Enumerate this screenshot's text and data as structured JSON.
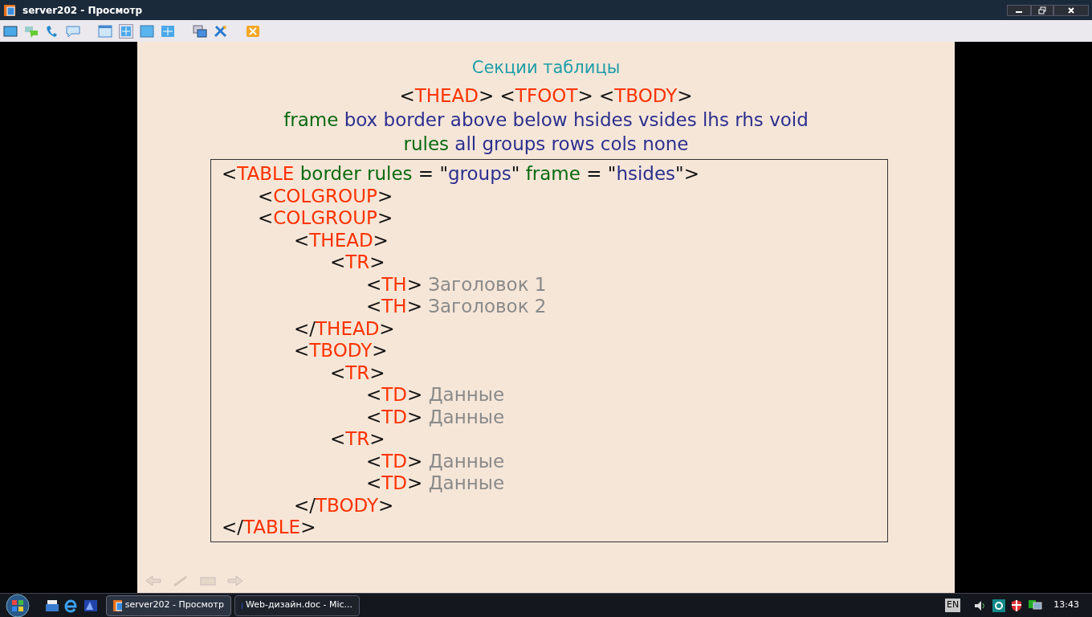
{
  "window": {
    "title": "server202 - Просмотр"
  },
  "slide": {
    "title": "Секции таблицы",
    "headings": [
      [
        {
          "kind": "punct",
          "text": "<"
        },
        {
          "kind": "tag",
          "text": "THEAD"
        },
        {
          "kind": "punct",
          "text": "> <"
        },
        {
          "kind": "tag",
          "text": "TFOOT"
        },
        {
          "kind": "punct",
          "text": "> <"
        },
        {
          "kind": "tag",
          "text": "TBODY"
        },
        {
          "kind": "punct",
          "text": ">"
        }
      ],
      [
        {
          "kind": "attr",
          "text": "frame"
        },
        {
          "kind": "value",
          "text": " box border above below hsides vsides lhs rhs void"
        }
      ],
      [
        {
          "kind": "attr",
          "text": "rules"
        },
        {
          "kind": "value",
          "text": " all groups rows cols none"
        }
      ]
    ],
    "code": [
      {
        "parts": [
          {
            "kind": "punct",
            "text": "<"
          },
          {
            "kind": "tag",
            "text": "TABLE"
          },
          {
            "kind": "attr",
            "text": " border rules"
          },
          {
            "kind": "punct",
            "text": " = \""
          },
          {
            "kind": "value",
            "text": "groups"
          },
          {
            "kind": "punct",
            "text": "\""
          },
          {
            "kind": "attr",
            "text": " frame"
          },
          {
            "kind": "punct",
            "text": " = \""
          },
          {
            "kind": "value",
            "text": "hsides"
          },
          {
            "kind": "punct",
            "text": "\">"
          }
        ],
        "children": [
          {
            "parts": [
              {
                "kind": "punct",
                "text": "<"
              },
              {
                "kind": "tag",
                "text": "COLGROUP"
              },
              {
                "kind": "punct",
                "text": ">"
              }
            ]
          },
          {
            "parts": [
              {
                "kind": "punct",
                "text": "<"
              },
              {
                "kind": "tag",
                "text": "COLGROUP"
              },
              {
                "kind": "punct",
                "text": ">"
              }
            ],
            "children": [
              {
                "parts": [
                  {
                    "kind": "punct",
                    "text": "<"
                  },
                  {
                    "kind": "tag",
                    "text": "THEAD"
                  },
                  {
                    "kind": "punct",
                    "text": ">"
                  }
                ],
                "children": [
                  {
                    "parts": [
                      {
                        "kind": "punct",
                        "text": "<"
                      },
                      {
                        "kind": "tag",
                        "text": "TR"
                      },
                      {
                        "kind": "punct",
                        "text": ">"
                      }
                    ],
                    "children": [
                      {
                        "parts": [
                          {
                            "kind": "punct",
                            "text": "<"
                          },
                          {
                            "kind": "tag",
                            "text": "TH"
                          },
                          {
                            "kind": "punct",
                            "text": ">"
                          },
                          {
                            "kind": "text",
                            "text": " Заголовок 1"
                          }
                        ]
                      },
                      {
                        "parts": [
                          {
                            "kind": "punct",
                            "text": "<"
                          },
                          {
                            "kind": "tag",
                            "text": "TH"
                          },
                          {
                            "kind": "punct",
                            "text": ">"
                          },
                          {
                            "kind": "text",
                            "text": " Заголовок 2"
                          }
                        ]
                      }
                    ]
                  }
                ]
              },
              {
                "parts": [
                  {
                    "kind": "punct",
                    "text": "</"
                  },
                  {
                    "kind": "tag",
                    "text": "THEAD"
                  },
                  {
                    "kind": "punct",
                    "text": ">"
                  }
                ]
              },
              {
                "parts": [
                  {
                    "kind": "punct",
                    "text": "<"
                  },
                  {
                    "kind": "tag",
                    "text": "TBODY"
                  },
                  {
                    "kind": "punct",
                    "text": ">"
                  }
                ],
                "children": [
                  {
                    "parts": [
                      {
                        "kind": "punct",
                        "text": "<"
                      },
                      {
                        "kind": "tag",
                        "text": "TR"
                      },
                      {
                        "kind": "punct",
                        "text": ">"
                      }
                    ],
                    "children": [
                      {
                        "parts": [
                          {
                            "kind": "punct",
                            "text": "<"
                          },
                          {
                            "kind": "tag",
                            "text": "TD"
                          },
                          {
                            "kind": "punct",
                            "text": ">"
                          },
                          {
                            "kind": "text",
                            "text": " Данные"
                          }
                        ]
                      },
                      {
                        "parts": [
                          {
                            "kind": "punct",
                            "text": "<"
                          },
                          {
                            "kind": "tag",
                            "text": "TD"
                          },
                          {
                            "kind": "punct",
                            "text": ">"
                          },
                          {
                            "kind": "text",
                            "text": " Данные"
                          }
                        ]
                      }
                    ]
                  },
                  {
                    "parts": [
                      {
                        "kind": "punct",
                        "text": "<"
                      },
                      {
                        "kind": "tag",
                        "text": "TR"
                      },
                      {
                        "kind": "punct",
                        "text": ">"
                      }
                    ],
                    "children": [
                      {
                        "parts": [
                          {
                            "kind": "punct",
                            "text": "<"
                          },
                          {
                            "kind": "tag",
                            "text": "TD"
                          },
                          {
                            "kind": "punct",
                            "text": ">"
                          },
                          {
                            "kind": "text",
                            "text": " Данные"
                          }
                        ]
                      },
                      {
                        "parts": [
                          {
                            "kind": "punct",
                            "text": "<"
                          },
                          {
                            "kind": "tag",
                            "text": "TD"
                          },
                          {
                            "kind": "punct",
                            "text": ">"
                          },
                          {
                            "kind": "text",
                            "text": " Данные"
                          }
                        ]
                      }
                    ]
                  }
                ]
              },
              {
                "parts": [
                  {
                    "kind": "punct",
                    "text": "</"
                  },
                  {
                    "kind": "tag",
                    "text": "TBODY"
                  },
                  {
                    "kind": "punct",
                    "text": ">"
                  }
                ]
              }
            ]
          }
        ]
      },
      {
        "parts": [
          {
            "kind": "punct",
            "text": "</"
          },
          {
            "kind": "tag",
            "text": "TABLE"
          },
          {
            "kind": "punct",
            "text": ">"
          }
        ]
      }
    ]
  },
  "taskbar": {
    "tasks": [
      {
        "label": "server202 - Просмотр",
        "selected": true
      },
      {
        "label": "Web-дизайн.doc - Mic...",
        "selected": false
      }
    ],
    "language": "EN",
    "clock": "13:43"
  }
}
